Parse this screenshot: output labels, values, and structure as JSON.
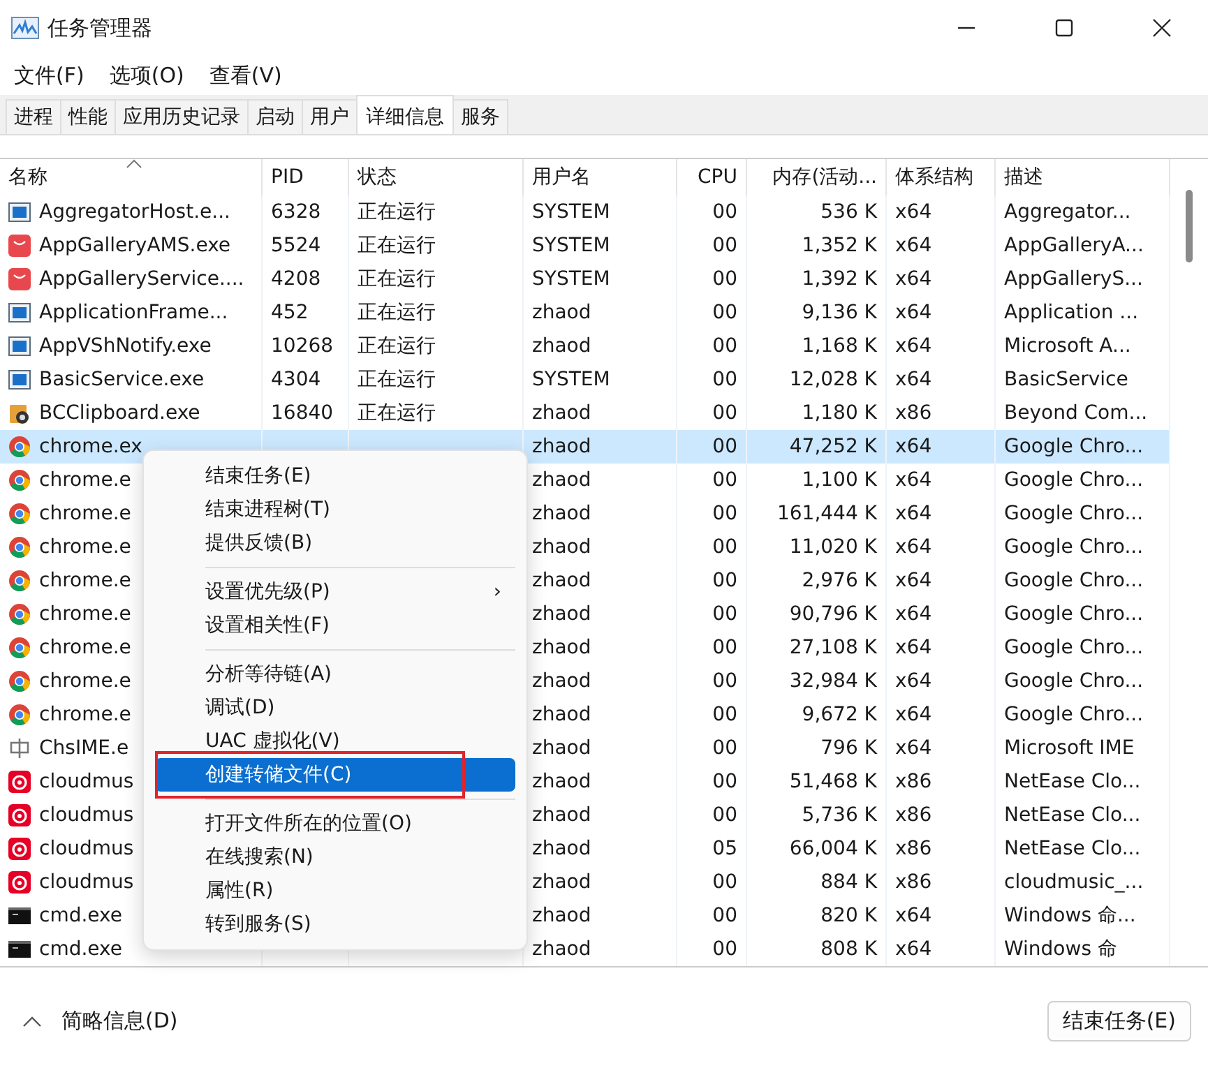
{
  "window": {
    "title": "任务管理器"
  },
  "menu_bar": [
    "文件(F)",
    "选项(O)",
    "查看(V)"
  ],
  "tabs": [
    {
      "label": "进程",
      "selected": false
    },
    {
      "label": "性能",
      "selected": false
    },
    {
      "label": "应用历史记录",
      "selected": false
    },
    {
      "label": "启动",
      "selected": false
    },
    {
      "label": "用户",
      "selected": false
    },
    {
      "label": "详细信息",
      "selected": true
    },
    {
      "label": "服务",
      "selected": false
    }
  ],
  "table": {
    "columns": [
      "名称",
      "PID",
      "状态",
      "用户名",
      "CPU",
      "内存(活动...",
      "体系结构",
      "描述"
    ],
    "rows": [
      {
        "kind": "app",
        "name": "AggregatorHost.e...",
        "pid": "6328",
        "status": "正在运行",
        "user": "SYSTEM",
        "cpu": "00",
        "memory": "536 K",
        "arch": "x64",
        "description": "Aggregator...",
        "selected": false
      },
      {
        "kind": "gallery",
        "name": "AppGalleryAMS.exe",
        "pid": "5524",
        "status": "正在运行",
        "user": "SYSTEM",
        "cpu": "00",
        "memory": "1,352 K",
        "arch": "x64",
        "description": "AppGalleryA...",
        "selected": false
      },
      {
        "kind": "gallery",
        "name": "AppGalleryService....",
        "pid": "4208",
        "status": "正在运行",
        "user": "SYSTEM",
        "cpu": "00",
        "memory": "1,392 K",
        "arch": "x64",
        "description": "AppGalleryS...",
        "selected": false
      },
      {
        "kind": "app",
        "name": "ApplicationFrame...",
        "pid": "452",
        "status": "正在运行",
        "user": "zhaod",
        "cpu": "00",
        "memory": "9,136 K",
        "arch": "x64",
        "description": "Application ...",
        "selected": false
      },
      {
        "kind": "app",
        "name": "AppVShNotify.exe",
        "pid": "10268",
        "status": "正在运行",
        "user": "zhaod",
        "cpu": "00",
        "memory": "1,168 K",
        "arch": "x64",
        "description": "Microsoft A...",
        "selected": false
      },
      {
        "kind": "app",
        "name": "BasicService.exe",
        "pid": "4304",
        "status": "正在运行",
        "user": "SYSTEM",
        "cpu": "00",
        "memory": "12,028 K",
        "arch": "x64",
        "description": "BasicService",
        "selected": false
      },
      {
        "kind": "clipboard",
        "name": "BCClipboard.exe",
        "pid": "16840",
        "status": "正在运行",
        "user": "zhaod",
        "cpu": "00",
        "memory": "1,180 K",
        "arch": "x86",
        "description": "Beyond Com...",
        "selected": false
      },
      {
        "kind": "browser",
        "name": "chrome.ex",
        "user": "zhaod",
        "cpu": "00",
        "memory": "47,252 K",
        "arch": "x64",
        "description": "Google Chro...",
        "selected": true
      },
      {
        "kind": "browser",
        "name": "chrome.e",
        "user": "zhaod",
        "cpu": "00",
        "memory": "1,100 K",
        "arch": "x64",
        "description": "Google Chro...",
        "selected": false
      },
      {
        "kind": "browser",
        "name": "chrome.e",
        "user": "zhaod",
        "cpu": "00",
        "memory": "161,444 K",
        "arch": "x64",
        "description": "Google Chro...",
        "selected": false
      },
      {
        "kind": "browser",
        "name": "chrome.e",
        "user": "zhaod",
        "cpu": "00",
        "memory": "11,020 K",
        "arch": "x64",
        "description": "Google Chro...",
        "selected": false
      },
      {
        "kind": "browser",
        "name": "chrome.e",
        "user": "zhaod",
        "cpu": "00",
        "memory": "2,976 K",
        "arch": "x64",
        "description": "Google Chro...",
        "selected": false
      },
      {
        "kind": "browser",
        "name": "chrome.e",
        "user": "zhaod",
        "cpu": "00",
        "memory": "90,796 K",
        "arch": "x64",
        "description": "Google Chro...",
        "selected": false
      },
      {
        "kind": "browser",
        "name": "chrome.e",
        "user": "zhaod",
        "cpu": "00",
        "memory": "27,108 K",
        "arch": "x64",
        "description": "Google Chro...",
        "selected": false
      },
      {
        "kind": "browser",
        "name": "chrome.e",
        "user": "zhaod",
        "cpu": "00",
        "memory": "32,984 K",
        "arch": "x64",
        "description": "Google Chro...",
        "selected": false
      },
      {
        "kind": "browser",
        "name": "chrome.e",
        "user": "zhaod",
        "cpu": "00",
        "memory": "9,672 K",
        "arch": "x64",
        "description": "Google Chro...",
        "selected": false
      },
      {
        "kind": "ime",
        "name": "ChsIME.e",
        "user": "zhaod",
        "cpu": "00",
        "memory": "796 K",
        "arch": "x64",
        "description": "Microsoft IME",
        "selected": false
      },
      {
        "kind": "music",
        "name": "cloudmus",
        "user": "zhaod",
        "cpu": "00",
        "memory": "51,468 K",
        "arch": "x86",
        "description": "NetEase Clo...",
        "selected": false
      },
      {
        "kind": "music",
        "name": "cloudmus",
        "user": "zhaod",
        "cpu": "00",
        "memory": "5,736 K",
        "arch": "x86",
        "description": "NetEase Clo...",
        "selected": false
      },
      {
        "kind": "music",
        "name": "cloudmus",
        "user": "zhaod",
        "cpu": "05",
        "memory": "66,004 K",
        "arch": "x86",
        "description": "NetEase Clo...",
        "selected": false
      },
      {
        "kind": "music",
        "name": "cloudmus",
        "user": "zhaod",
        "cpu": "00",
        "memory": "884 K",
        "arch": "x86",
        "description": "cloudmusic_...",
        "selected": false
      },
      {
        "kind": "console",
        "name": "cmd.exe",
        "user": "zhaod",
        "cpu": "00",
        "memory": "820 K",
        "arch": "x64",
        "description": "Windows 命...",
        "selected": false
      },
      {
        "kind": "console",
        "name": "cmd.exe",
        "user": "zhaod",
        "cpu": "00",
        "memory": "808 K",
        "arch": "x64",
        "description": "Windows 命",
        "selected": false
      }
    ]
  },
  "context_menu": [
    {
      "kind": "item",
      "label": "结束任务(E)",
      "selected": false
    },
    {
      "kind": "item",
      "label": "结束进程树(T)",
      "selected": false
    },
    {
      "kind": "item",
      "label": "提供反馈(B)",
      "selected": false
    },
    {
      "kind": "separator"
    },
    {
      "kind": "submenu",
      "label": "设置优先级(P)",
      "arrow": "›",
      "selected": false
    },
    {
      "kind": "item",
      "label": "设置相关性(F)",
      "selected": false
    },
    {
      "kind": "separator"
    },
    {
      "kind": "item",
      "label": "分析等待链(A)",
      "selected": false
    },
    {
      "kind": "item",
      "label": "调试(D)",
      "selected": false
    },
    {
      "kind": "item",
      "label": "UAC 虚拟化(V)",
      "selected": false
    },
    {
      "kind": "item",
      "label": "创建转储文件(C)",
      "selected": true,
      "framed": true
    },
    {
      "kind": "separator"
    },
    {
      "kind": "item",
      "label": "打开文件所在的位置(O)",
      "selected": false
    },
    {
      "kind": "item",
      "label": "在线搜索(N)",
      "selected": false
    },
    {
      "kind": "item",
      "label": "属性(R)",
      "selected": false
    },
    {
      "kind": "item",
      "label": "转到服务(S)",
      "selected": false
    }
  ],
  "footer": {
    "details_toggle": "简略信息(D)",
    "end_task_button": "结束任务(E)"
  }
}
